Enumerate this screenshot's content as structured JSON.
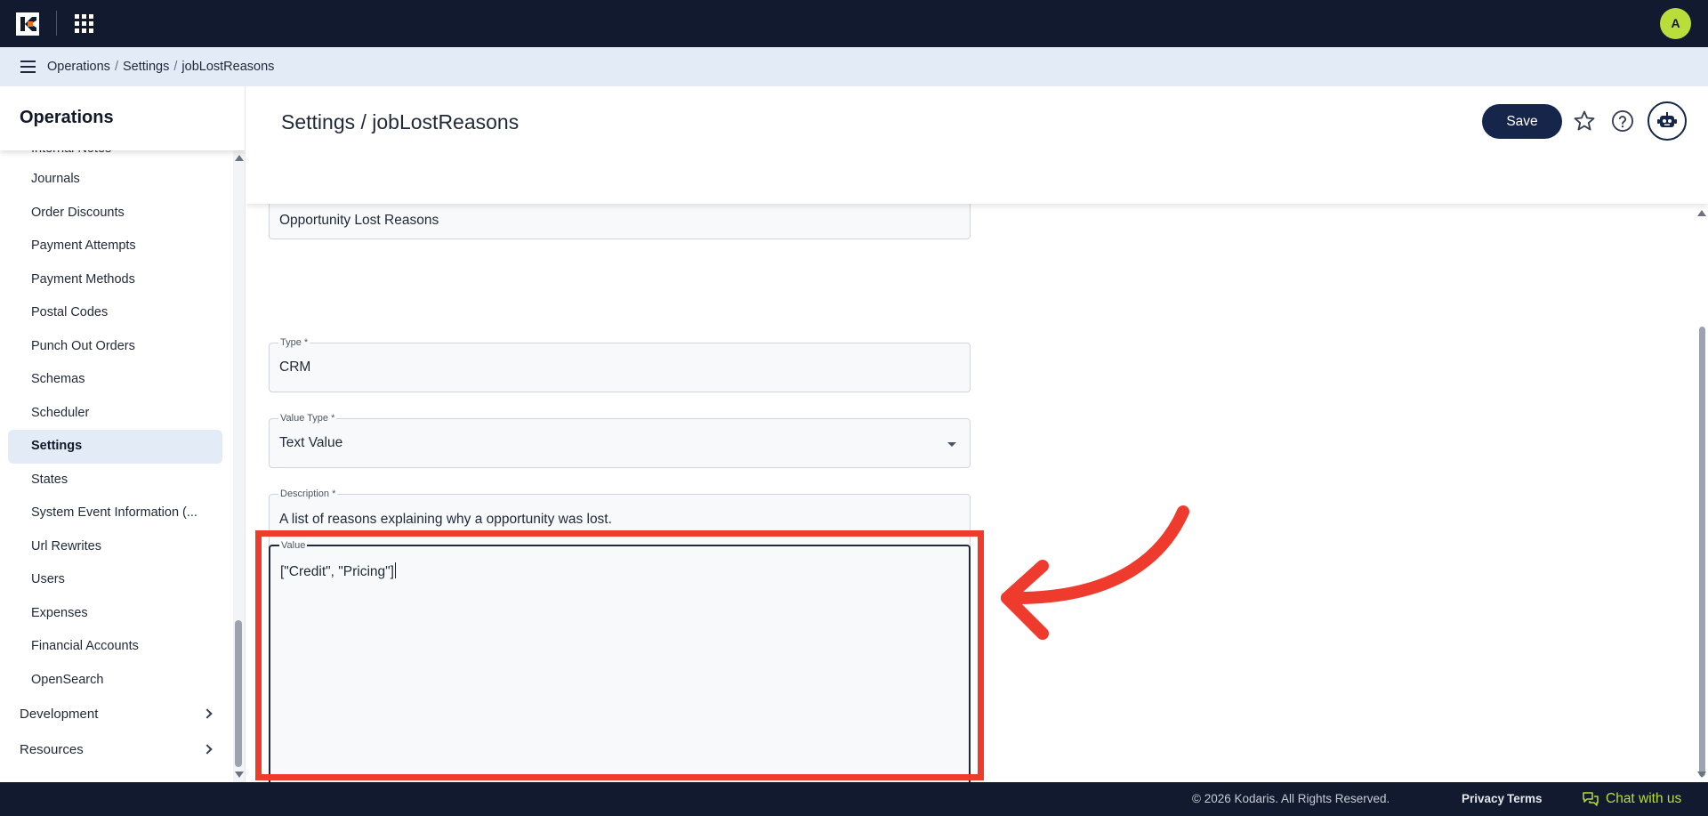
{
  "header": {
    "avatar_initial": "A"
  },
  "breadcrumb": {
    "items": [
      "Operations",
      "Settings",
      "jobLostReasons"
    ]
  },
  "sidebar": {
    "title": "Operations",
    "items": [
      {
        "label": "Internal Notes",
        "active": false
      },
      {
        "label": "Journals",
        "active": false
      },
      {
        "label": "Order Discounts",
        "active": false
      },
      {
        "label": "Payment Attempts",
        "active": false
      },
      {
        "label": "Payment Methods",
        "active": false
      },
      {
        "label": "Postal Codes",
        "active": false
      },
      {
        "label": "Punch Out Orders",
        "active": false
      },
      {
        "label": "Schemas",
        "active": false
      },
      {
        "label": "Scheduler",
        "active": false
      },
      {
        "label": "Settings",
        "active": true
      },
      {
        "label": "States",
        "active": false
      },
      {
        "label": "System Event Information (...",
        "active": false
      },
      {
        "label": "Url Rewrites",
        "active": false
      },
      {
        "label": "Users",
        "active": false
      },
      {
        "label": "Expenses",
        "active": false
      },
      {
        "label": "Financial Accounts",
        "active": false
      },
      {
        "label": "OpenSearch",
        "active": false
      }
    ],
    "groups": [
      {
        "label": "Development"
      },
      {
        "label": "Resources"
      }
    ]
  },
  "main": {
    "title": "Settings / jobLostReasons",
    "save_label": "Save",
    "fields": {
      "name": {
        "value": "Opportunity Lost Reasons"
      },
      "type": {
        "label": "Type *",
        "value": "CRM"
      },
      "value_type": {
        "label": "Value Type *",
        "value": "Text Value"
      },
      "description": {
        "label": "Description *",
        "value": "A list of reasons explaining why a opportunity was lost."
      },
      "value": {
        "label": "Value",
        "value": "[\"Credit\", \"Pricing\"]"
      }
    }
  },
  "footer": {
    "copyright": "© 2026 Kodaris. All Rights Reserved.",
    "privacy": "Privacy",
    "terms": "Terms",
    "chat": "Chat with us"
  },
  "colors": {
    "topbar": "#111a2e",
    "accent": "#b9dd3a",
    "primary_button": "#15264a",
    "annotation": "#ef3b2d",
    "breadcrumb_bar": "#e3ebf7"
  }
}
